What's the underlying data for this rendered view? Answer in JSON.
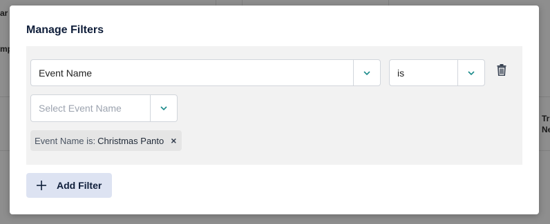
{
  "background": {
    "fragments": [
      "ar",
      "mp",
      "Tr",
      "Ne"
    ]
  },
  "modal": {
    "title": "Manage Filters",
    "filter": {
      "field_select": {
        "value": "Event Name"
      },
      "operator_select": {
        "value": "is"
      },
      "value_select": {
        "placeholder": "Select Event Name"
      },
      "chip": {
        "key": "Event Name is:",
        "value": "Christmas Panto",
        "remove": "×"
      }
    },
    "add_filter_label": "Add Filter"
  },
  "colors": {
    "accent_caret": "#1a8a8a",
    "button_bg": "#dde3f2",
    "panel_bg": "#f2f2f2"
  },
  "icons": [
    "chevron-down-icon",
    "trash-icon",
    "close-icon",
    "plus-icon"
  ]
}
